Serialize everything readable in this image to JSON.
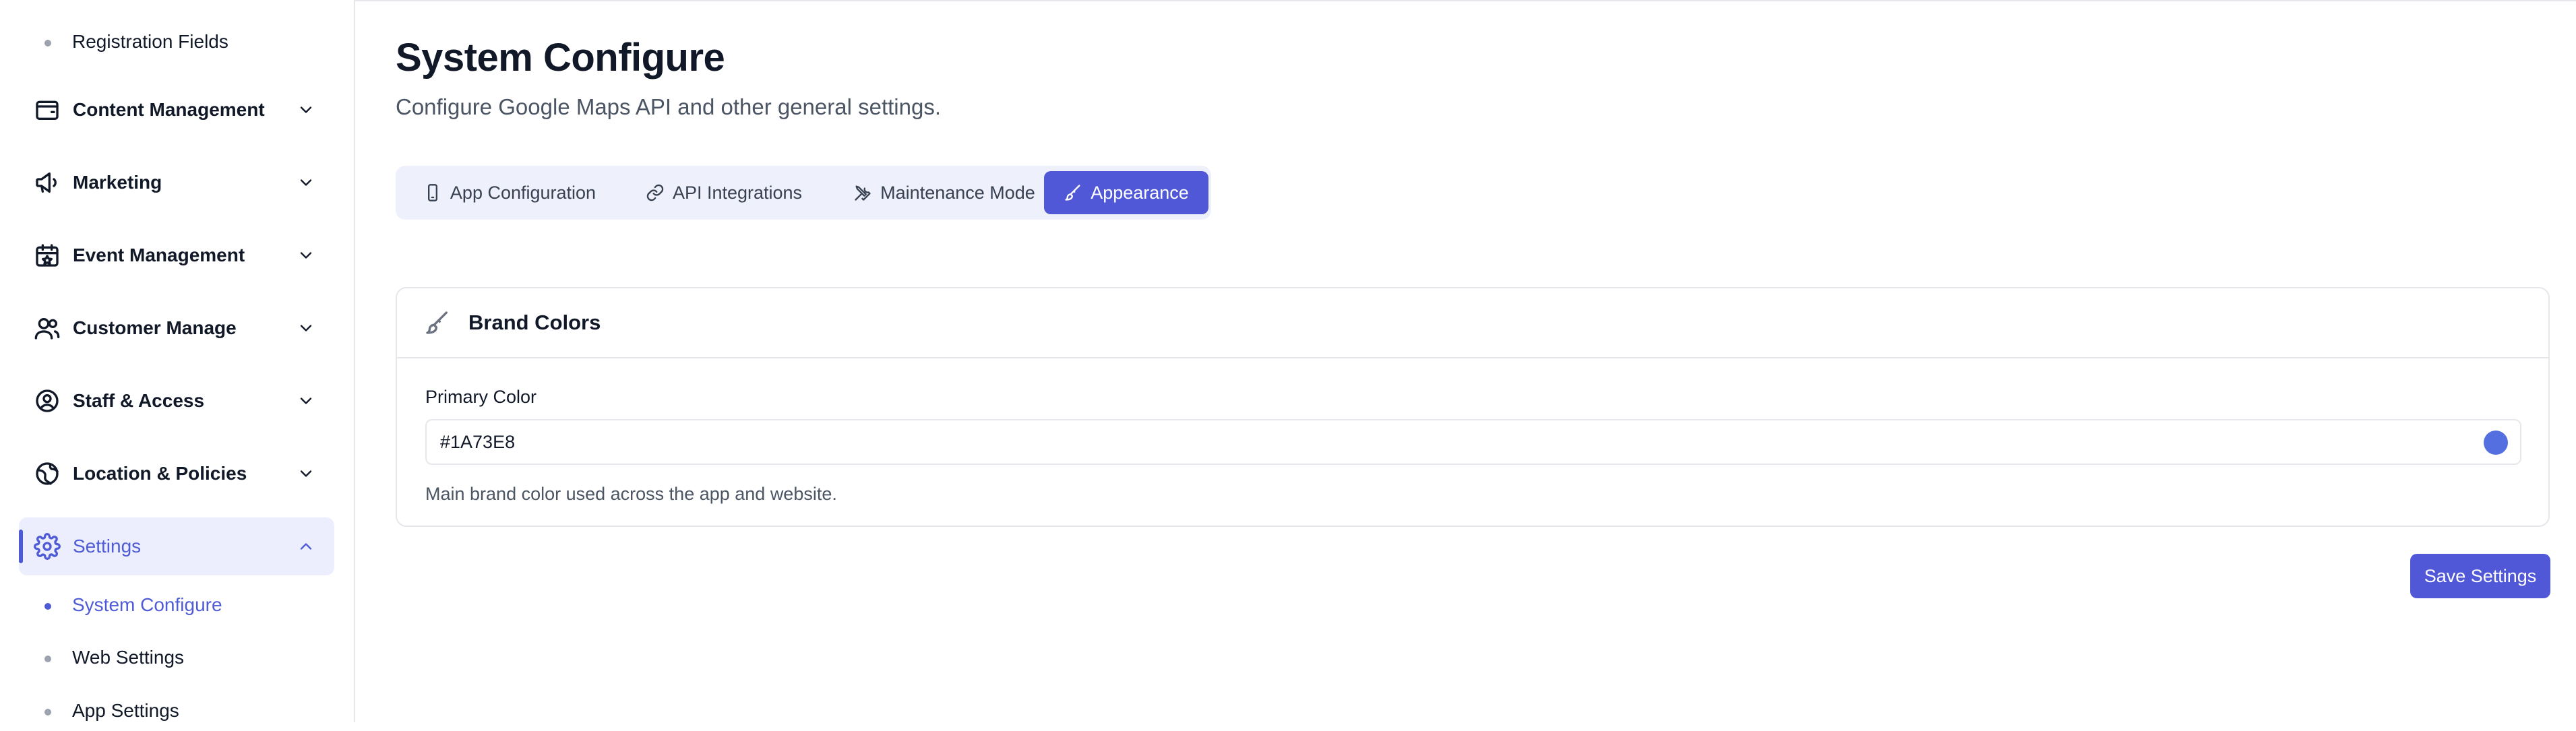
{
  "sidebar": {
    "top_sub_item": "Registration Fields",
    "items": [
      {
        "label": "Content Management",
        "icon": "wallet-icon"
      },
      {
        "label": "Marketing",
        "icon": "megaphone-icon"
      },
      {
        "label": "Event Management",
        "icon": "calendar-star-icon"
      },
      {
        "label": "Customer Manage",
        "icon": "users-icon"
      },
      {
        "label": "Staff & Access",
        "icon": "user-circle-icon"
      },
      {
        "label": "Location & Policies",
        "icon": "globe-icon"
      },
      {
        "label": "Settings",
        "icon": "gear-icon",
        "active": true
      }
    ],
    "settings_sub": [
      {
        "label": "System Configure",
        "active": true
      },
      {
        "label": "Web Settings"
      },
      {
        "label": "App Settings"
      }
    ]
  },
  "page": {
    "title": "System Configure",
    "subtitle": "Configure Google Maps API and other general settings."
  },
  "tabs": [
    {
      "label": "App Configuration",
      "icon": "smartphone-icon"
    },
    {
      "label": "API Integrations",
      "icon": "link-icon"
    },
    {
      "label": "Maintenance Mode",
      "icon": "tools-icon"
    },
    {
      "label": "Appearance",
      "icon": "brush-icon",
      "active": true
    }
  ],
  "brand_colors": {
    "title": "Brand Colors",
    "primary_label": "Primary Color",
    "primary_value": "#1A73E8",
    "help": "Main brand color used across the app and website.",
    "swatch_color": "#5470E0"
  },
  "actions": {
    "save_label": "Save Settings"
  },
  "colors": {
    "accent": "#5058D8",
    "active_bg": "#ECEEFE"
  }
}
